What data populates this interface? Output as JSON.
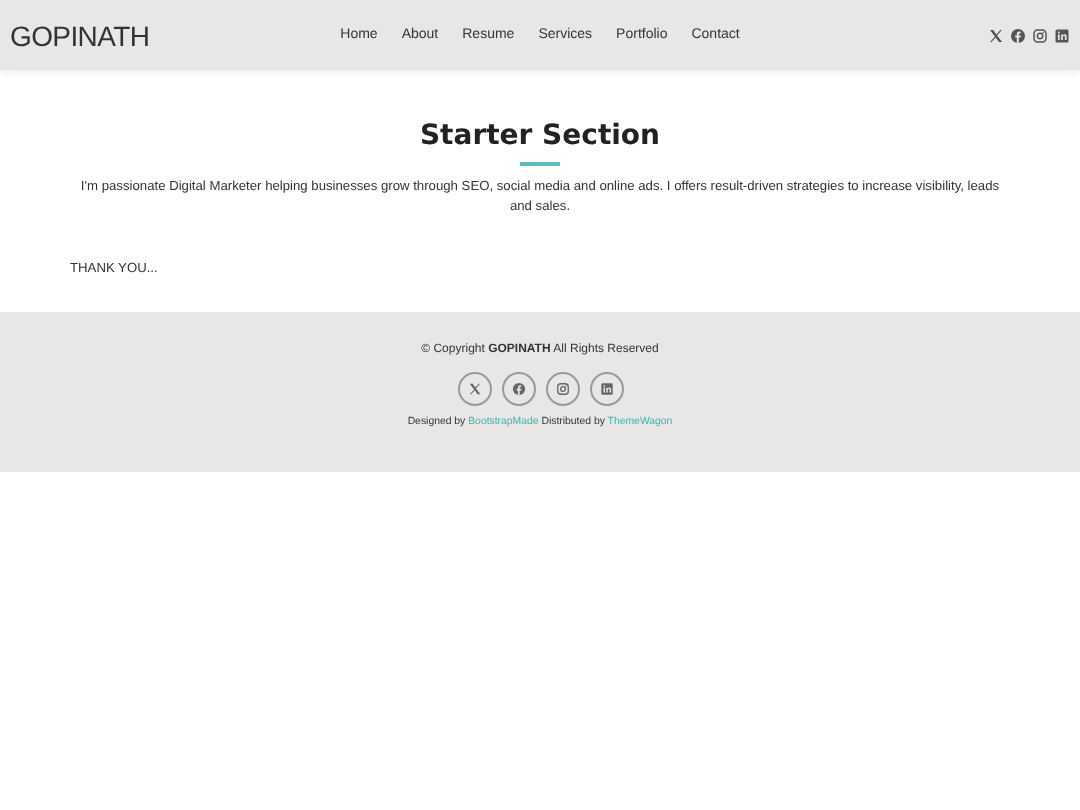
{
  "header": {
    "logo": "GOPINATH",
    "nav": [
      "Home",
      "About",
      "Resume",
      "Services",
      "Portfolio",
      "Contact"
    ],
    "social": [
      {
        "kind": "x"
      },
      {
        "kind": "facebook"
      },
      {
        "kind": "instagram"
      },
      {
        "kind": "linkedin"
      }
    ]
  },
  "section": {
    "title": "Starter Section",
    "text": "I'm passionate Digital Marketer helping businesses grow through SEO, social media and online ads. I offers result-driven strategies to increase visibility, leads and sales.",
    "note": "THANK YOU..."
  },
  "footer": {
    "copyright": "© Copyright **GOPINATH** All Rights Reserved",
    "social": [
      {
        "kind": "x"
      },
      {
        "kind": "facebook"
      },
      {
        "kind": "instagram"
      },
      {
        "kind": "linkedin"
      }
    ],
    "credits": {
      "designed": "Designed by",
      "designer": "BootstrapMade",
      "distributed": "Distributed by",
      "distributor": "ThemeWagon"
    }
  }
}
